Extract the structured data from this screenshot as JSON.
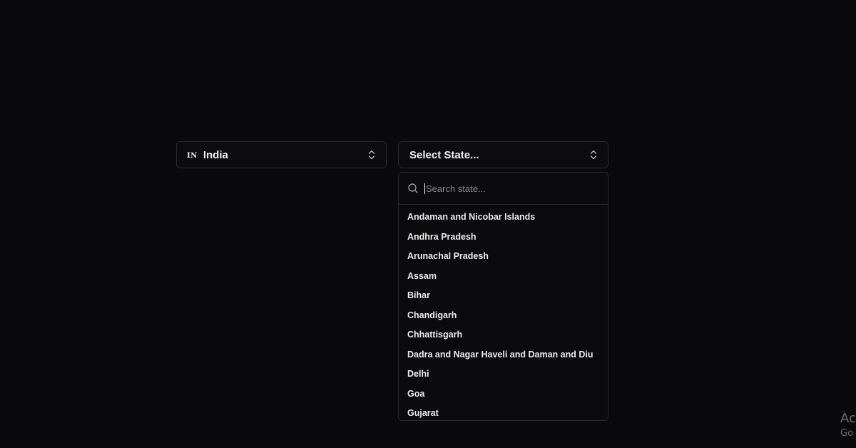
{
  "country_select": {
    "flag_code": "IN",
    "value": "India",
    "chevron_icon": "chevrons-up-down-icon"
  },
  "state_select": {
    "placeholder": "Select State...",
    "chevron_icon": "chevrons-up-down-icon"
  },
  "dropdown": {
    "search_icon": "search-icon",
    "search_placeholder": "Search state...",
    "search_value": "",
    "options": [
      "Andaman and Nicobar Islands",
      "Andhra Pradesh",
      "Arunachal Pradesh",
      "Assam",
      "Bihar",
      "Chandigarh",
      "Chhattisgarh",
      "Dadra and Nagar Haveli and Daman and Diu",
      "Delhi",
      "Goa",
      "Gujarat"
    ]
  },
  "watermark": {
    "line1": "Ac",
    "line2": "Go"
  }
}
